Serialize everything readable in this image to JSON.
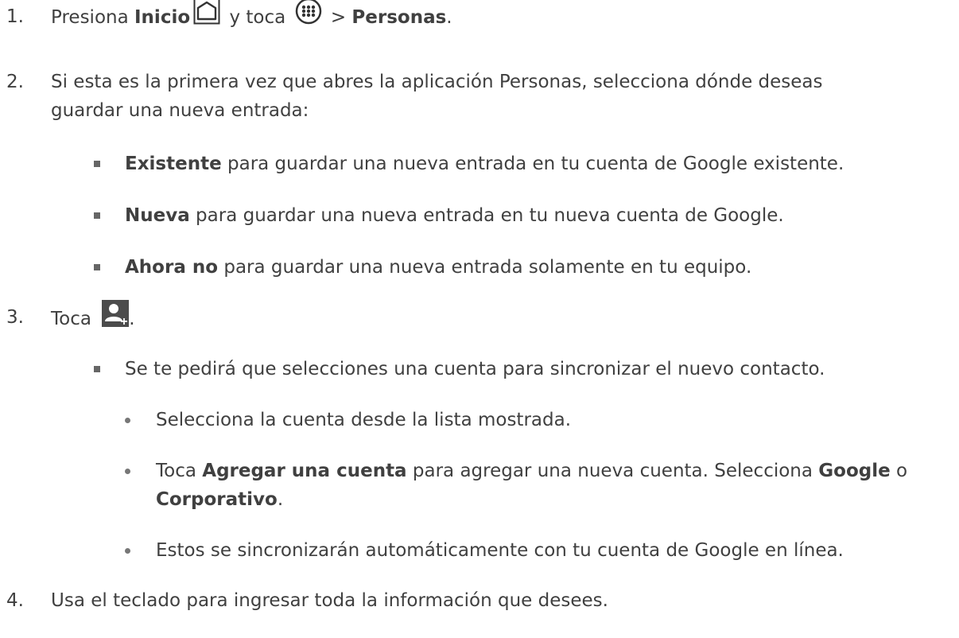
{
  "step1": {
    "num": "1.",
    "pre": "Presiona ",
    "inicio": "Inicio",
    "mid": " y toca ",
    "sep": " > ",
    "personas": "Personas",
    "end": "."
  },
  "step2": {
    "num": "2.",
    "line1": "Si esta es la primera vez que abres la aplicación Personas, selecciona dónde deseas",
    "line2": "guardar una nueva entrada:",
    "opt1_bold": "Existente",
    "opt1_text": " para guardar una nueva entrada en tu cuenta de Google existente.",
    "opt2_bold": "Nueva",
    "opt2_text": " para guardar una nueva entrada en tu nueva cuenta de Google.",
    "opt3_bold": "Ahora no",
    "opt3_text": " para guardar una nueva entrada solamente en tu equipo."
  },
  "step3": {
    "num": "3.",
    "pre": "Toca ",
    "end": ".",
    "sub": "Se te pedirá que selecciones una cuenta para sincronizar el nuevo contacto.",
    "b1": "Selecciona la cuenta desde la lista mostrada.",
    "b2_pre": "Toca ",
    "b2_bold": "Agregar una cuenta",
    "b2_mid": " para agregar una nueva cuenta. Selecciona ",
    "b2_google": "Google",
    "b2_o": " o",
    "b2_corp": "Corporativo",
    "b2_end": ".",
    "b3": "Estos se sincronizarán automáticamente con tu cuenta de Google en línea."
  },
  "step4": {
    "num": "4.",
    "text": "Usa el teclado para ingresar toda la información que desees."
  },
  "icons": [
    "home-icon",
    "apps-icon",
    "add-contact-icon"
  ]
}
